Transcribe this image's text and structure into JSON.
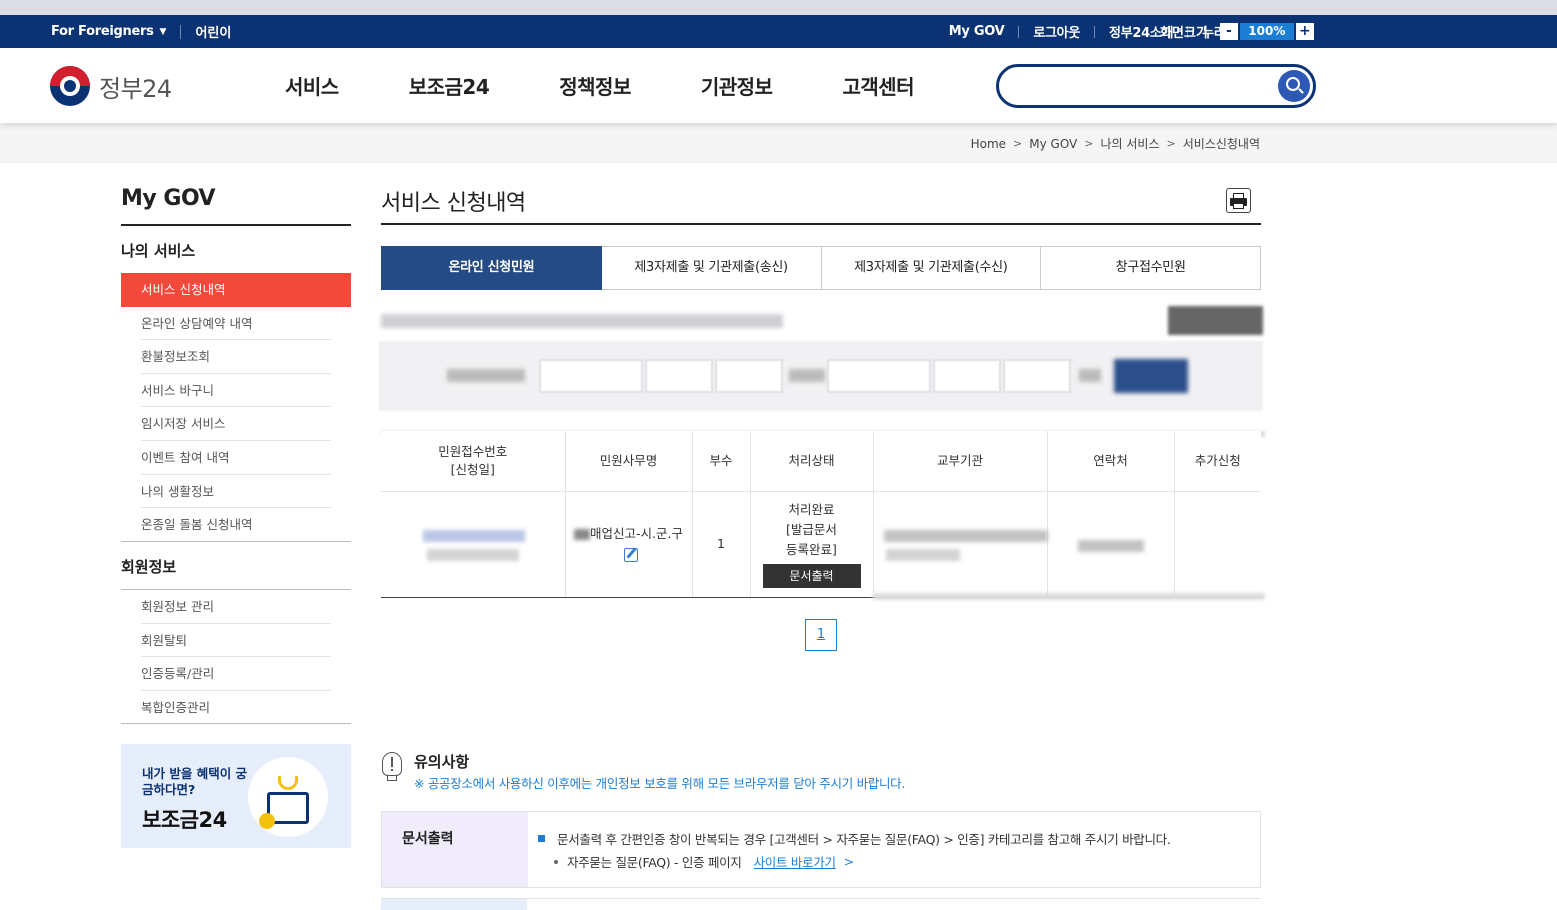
{
  "util": {
    "for_foreigners": "For Foreigners",
    "kids": "어린이",
    "right_items": [
      "My GOV",
      "로그아웃",
      "정부24소개",
      "누리집 안내지도"
    ],
    "zoom_label": "화면크기",
    "zoom_minus": "-",
    "zoom_value": "100%",
    "zoom_plus": "+"
  },
  "header": {
    "logo_text": "정부24",
    "nav": [
      "서비스",
      "보조금24",
      "정책정보",
      "기관정보",
      "고객센터"
    ],
    "search_placeholder": ""
  },
  "breadcrumb": [
    "Home",
    "My GOV",
    "나의 서비스",
    "서비스신청내역"
  ],
  "lnb": {
    "title": "My GOV",
    "group1": "나의 서비스",
    "group1_items": [
      "서비스 신청내역",
      "온라인 상담예약 내역",
      "환불정보조회",
      "서비스 바구니",
      "임시저장 서비스",
      "이벤트 참여 내역",
      "나의 생활정보",
      "온종일 돌봄 신청내역"
    ],
    "group2": "회원정보",
    "group2_items": [
      "회원정보 관리",
      "회원탈퇴",
      "인증등록/관리",
      "복합인증관리"
    ],
    "promo_line1": "내가 받을 혜택이 궁금하다면?",
    "promo_line2": "보조금24"
  },
  "content": {
    "title": "서비스 신청내역",
    "tabs": [
      "온라인 신청민원",
      "제3자제출 및 기관제출(송신)",
      "제3자제출 및 기관제출(수신)",
      "창구접수민원"
    ],
    "active_tab": 0,
    "table": {
      "headers": [
        "민원접수번호\n[신청일]",
        "민원사무명",
        "부수",
        "처리상태",
        "교부기관",
        "연락처",
        "추가신청"
      ],
      "row": {
        "service_name": "매업신고-시.군.구",
        "copies": "1",
        "status": "처리완료\n[발급문서\n등록완료]",
        "doc_button": "문서출력"
      }
    },
    "page": "1"
  },
  "notice": {
    "title": "유의사항",
    "subtitle": "※ 공공장소에서 사용하신 이후에는 개인정보 보호를 위해 모든 브라우저를 닫아 주시기 바랍니다.",
    "label": "문서출력",
    "line1": "문서출력 후 간편인증 창이 반복되는 경우 [고객센터 > 자주묻는 질문(FAQ) > 인증] 카테고리를 참고해 주시기 바랍니다.",
    "line2": "자주묻는 질문(FAQ) - 인증 페이지",
    "link": "사이트 바로가기"
  }
}
